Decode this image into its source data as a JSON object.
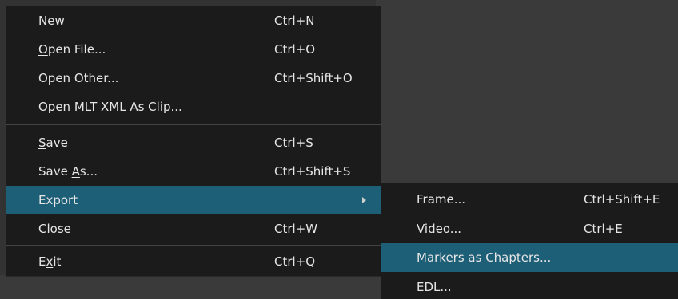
{
  "file_menu": {
    "items": [
      {
        "label": "New",
        "shortcut": "Ctrl+N"
      },
      {
        "label_pre": "",
        "label_u": "O",
        "label_post": "pen File...",
        "shortcut": "Ctrl+O"
      },
      {
        "label": "Open Other...",
        "shortcut": "Ctrl+Shift+O"
      },
      {
        "label": "Open MLT XML As Clip...",
        "shortcut": ""
      },
      {
        "label_pre": "",
        "label_u": "S",
        "label_post": "ave",
        "shortcut": "Ctrl+S"
      },
      {
        "label_pre": "Save ",
        "label_u": "A",
        "label_post": "s...",
        "shortcut": "Ctrl+Shift+S"
      },
      {
        "label": "Export",
        "shortcut": "",
        "has_submenu": true,
        "highlighted": true
      },
      {
        "label": "Close",
        "shortcut": "Ctrl+W"
      },
      {
        "label_pre": "E",
        "label_u": "x",
        "label_post": "it",
        "shortcut": "Ctrl+Q"
      }
    ]
  },
  "export_submenu": {
    "items": [
      {
        "label": "Frame...",
        "shortcut": "Ctrl+Shift+E"
      },
      {
        "label": "Video...",
        "shortcut": "Ctrl+E"
      },
      {
        "label": "Markers as Chapters...",
        "shortcut": "",
        "highlighted": true
      },
      {
        "label": "EDL...",
        "shortcut": ""
      }
    ]
  },
  "colors": {
    "menu_bg": "#1b1b1b",
    "highlight": "#1e5f78",
    "text": "#e6e6e6",
    "separator": "#444444"
  },
  "icons": {
    "submenu_arrow": "chevron-right-icon"
  }
}
